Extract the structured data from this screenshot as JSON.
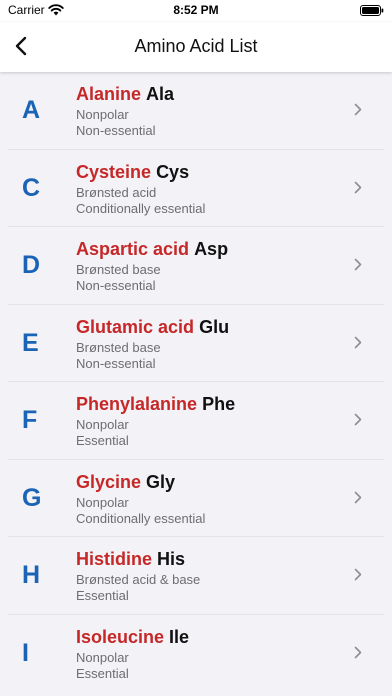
{
  "status": {
    "carrier": "Carrier",
    "time": "8:52 PM"
  },
  "nav": {
    "title": "Amino Acid List"
  },
  "colors": {
    "letter": "#1a63b5",
    "name": "#c62828",
    "subtitle": "#6d6d72"
  },
  "amino_acids": [
    {
      "letter": "A",
      "name": "Alanine",
      "abbr": "Ala",
      "property": "Nonpolar",
      "essentiality": "Non-essential"
    },
    {
      "letter": "C",
      "name": "Cysteine",
      "abbr": "Cys",
      "property": "Brønsted acid",
      "essentiality": "Conditionally essential"
    },
    {
      "letter": "D",
      "name": "Aspartic acid",
      "abbr": "Asp",
      "property": "Brønsted base",
      "essentiality": "Non-essential"
    },
    {
      "letter": "E",
      "name": "Glutamic acid",
      "abbr": "Glu",
      "property": "Brønsted base",
      "essentiality": "Non-essential"
    },
    {
      "letter": "F",
      "name": "Phenylalanine",
      "abbr": "Phe",
      "property": "Nonpolar",
      "essentiality": "Essential"
    },
    {
      "letter": "G",
      "name": "Glycine",
      "abbr": "Gly",
      "property": "Nonpolar",
      "essentiality": "Conditionally essential"
    },
    {
      "letter": "H",
      "name": "Histidine",
      "abbr": "His",
      "property": "Brønsted acid & base",
      "essentiality": "Essential"
    },
    {
      "letter": "I",
      "name": "Isoleucine",
      "abbr": "Ile",
      "property": "Nonpolar",
      "essentiality": "Essential"
    }
  ]
}
